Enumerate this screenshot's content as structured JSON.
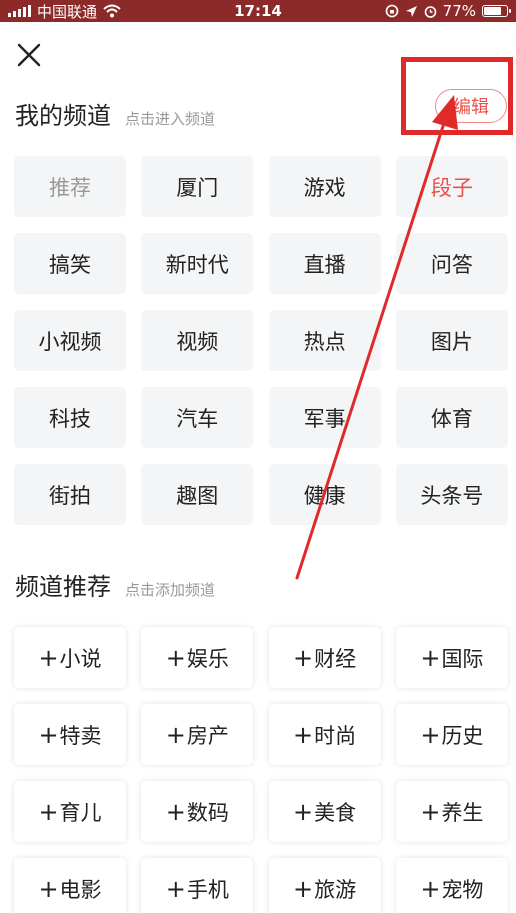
{
  "status_bar": {
    "carrier": "中国联通",
    "time": "17:14",
    "battery": "77%",
    "battery_level": 0.77
  },
  "close_icon": "close-icon",
  "my_channels": {
    "title": "我的频道",
    "hint": "点击进入频道",
    "edit_label": "编辑",
    "items": [
      {
        "label": "推荐",
        "style": "dim"
      },
      {
        "label": "厦门",
        "style": ""
      },
      {
        "label": "游戏",
        "style": ""
      },
      {
        "label": "段子",
        "style": "accent"
      },
      {
        "label": "搞笑",
        "style": ""
      },
      {
        "label": "新时代",
        "style": ""
      },
      {
        "label": "直播",
        "style": ""
      },
      {
        "label": "问答",
        "style": ""
      },
      {
        "label": "小视频",
        "style": ""
      },
      {
        "label": "视频",
        "style": ""
      },
      {
        "label": "热点",
        "style": ""
      },
      {
        "label": "图片",
        "style": ""
      },
      {
        "label": "科技",
        "style": ""
      },
      {
        "label": "汽车",
        "style": ""
      },
      {
        "label": "军事",
        "style": ""
      },
      {
        "label": "体育",
        "style": ""
      },
      {
        "label": "街拍",
        "style": ""
      },
      {
        "label": "趣图",
        "style": ""
      },
      {
        "label": "健康",
        "style": ""
      },
      {
        "label": "头条号",
        "style": ""
      }
    ]
  },
  "recommended": {
    "title": "频道推荐",
    "hint": "点击添加频道",
    "plus": "+",
    "items": [
      "小说",
      "娱乐",
      "财经",
      "国际",
      "特卖",
      "房产",
      "时尚",
      "历史",
      "育儿",
      "数码",
      "美食",
      "养生",
      "电影",
      "手机",
      "旅游",
      "宠物"
    ]
  },
  "colors": {
    "accent": "#e9524a",
    "annotation": "#e02a2a",
    "status_bar": "#8c2a2a"
  }
}
